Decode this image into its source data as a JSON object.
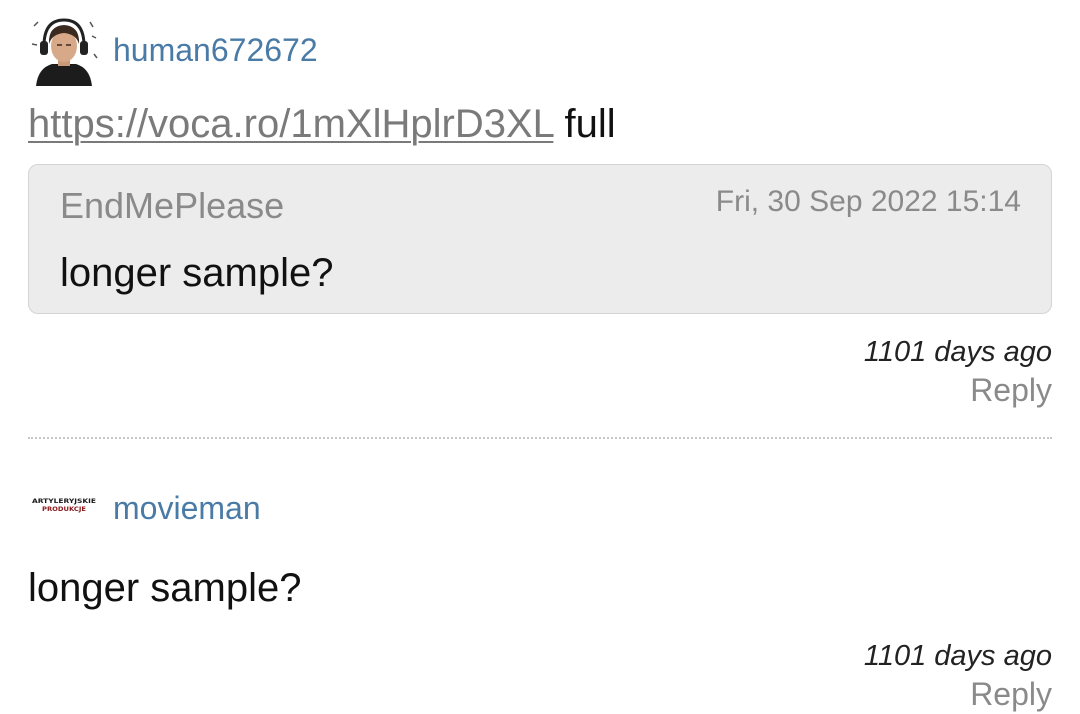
{
  "comments": [
    {
      "username": "human672672",
      "link_text": "https://voca.ro/1mXlHplrD3XL",
      "text_after_link": " full",
      "quote": {
        "author": "EndMePlease",
        "date": "Fri, 30 Sep 2022 15:14",
        "text": "longer sample?"
      },
      "time_ago": "1101 days ago",
      "reply_label": "Reply"
    },
    {
      "username": "movieman",
      "avatar_text": "ARTYLERYJSKIE PRODUKCJE",
      "text": "longer sample?",
      "time_ago": "1101 days ago",
      "reply_label": "Reply"
    }
  ],
  "colors": {
    "username": "#4a7aa6",
    "link": "#7a7a7a",
    "quote_bg": "#ececec",
    "muted": "#8a8a8a"
  }
}
